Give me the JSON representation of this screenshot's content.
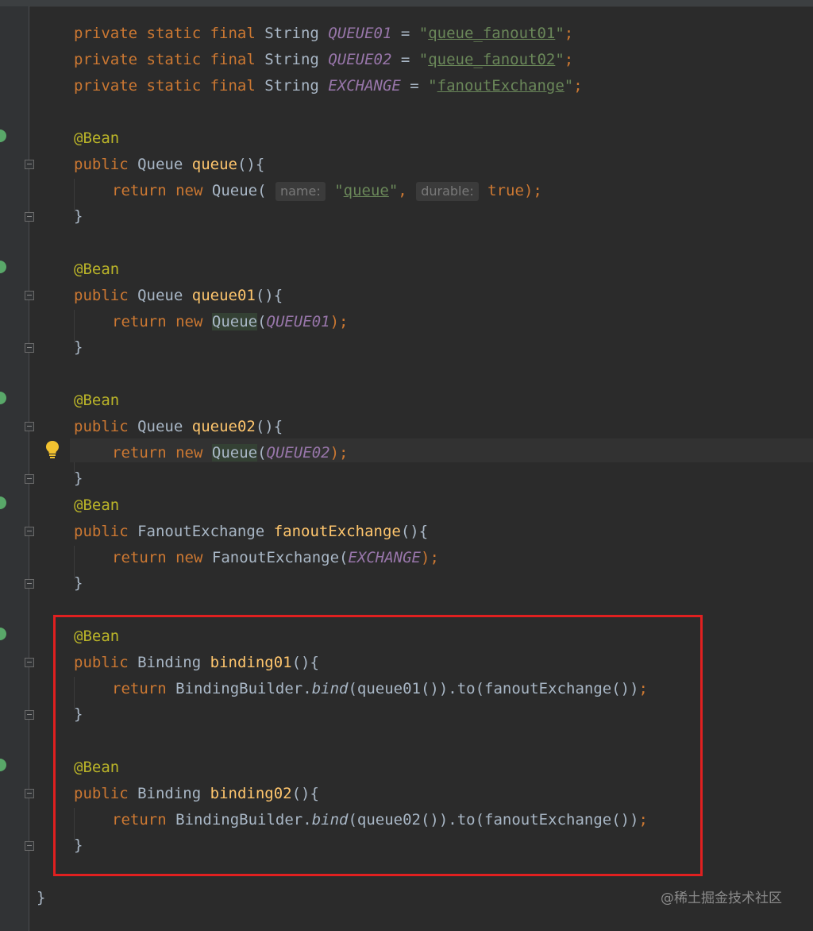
{
  "editor": {
    "lines": {
      "l1": {
        "kw1": "private static final",
        "type": "String",
        "const": "QUEUE01",
        "eq": " = ",
        "q1": "\"",
        "str": "queue_fanout01",
        "q2": "\"",
        "semi": ";"
      },
      "l2": {
        "kw1": "private static final",
        "type": "String",
        "const": "QUEUE02",
        "eq": " = ",
        "q1": "\"",
        "str": "queue_fanout02",
        "q2": "\"",
        "semi": ";"
      },
      "l3": {
        "kw1": "private static final",
        "type": "String",
        "const": "EXCHANGE",
        "eq": " = ",
        "q1": "\"",
        "str": "fanoutExchange",
        "q2": "\"",
        "semi": ";"
      }
    },
    "annotation": "@Bean",
    "public_kw": "public",
    "return_kw": "return",
    "new_kw": "new",
    "close_brace": "}",
    "m1": {
      "type": "Queue",
      "name": "queue",
      "sig": "(){",
      "ctor": "Queue",
      "hint_name": "name:",
      "arg_str": "queue",
      "hint_durable": "durable:",
      "arg_bool": "true",
      "tail": ");"
    },
    "m2": {
      "type": "Queue",
      "name": "queue01",
      "sig": "(){",
      "ctor": "Queue",
      "arg": "QUEUE01",
      "tail": ");"
    },
    "m3": {
      "type": "Queue",
      "name": "queue02",
      "sig": "(){",
      "ctor": "Queue",
      "arg": "QUEUE02",
      "tail": ");"
    },
    "m4": {
      "type": "FanoutExchange",
      "name": "fanoutExchange",
      "sig": "(){",
      "ctor": "FanoutExchange",
      "arg": "EXCHANGE",
      "tail": ");"
    },
    "m5": {
      "type": "Binding",
      "name": "binding01",
      "sig": "(){",
      "builder": "BindingBuilder",
      "bind": "bind",
      "call": "(queue01()).to(fanoutExchange())",
      "semi": ";"
    },
    "m6": {
      "type": "Binding",
      "name": "binding02",
      "sig": "(){",
      "builder": "BindingBuilder",
      "bind": "bind",
      "call": "(queue02()).to(fanoutExchange())",
      "semi": ";"
    },
    "class_close": "}"
  },
  "watermark": "@稀土掘金技术社区",
  "colors": {
    "background": "#2b2b2b",
    "keyword": "#cc7832",
    "method": "#ffc66d",
    "annotation": "#bbb529",
    "string": "#6a8759",
    "constant": "#9876aa",
    "highlight_box": "#e02020"
  }
}
